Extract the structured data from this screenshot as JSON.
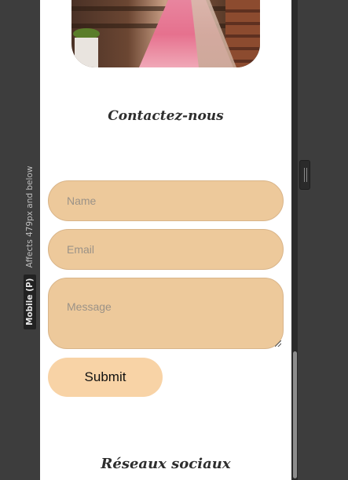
{
  "editor": {
    "device_label": "Mobile (P)",
    "device_note": "Affects 479px and below"
  },
  "page": {
    "contact_title": "Contactez-nous",
    "form": {
      "name_placeholder": "Name",
      "email_placeholder": "Email",
      "message_placeholder": "Message",
      "submit_label": "Submit"
    },
    "social_title": "Réseaux sociaux"
  },
  "colors": {
    "field_background": "#edc99b",
    "submit_background": "#f8d3a6",
    "dress": "#e6718e"
  }
}
